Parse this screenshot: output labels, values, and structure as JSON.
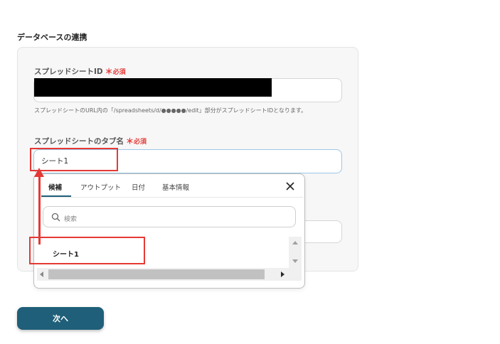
{
  "section": {
    "title": "データベースの連携"
  },
  "spreadsheet_id": {
    "label": "スプレッドシートID",
    "required_mark": "＊",
    "required_text": "必須",
    "help": "スプレッドシートのURL内の「/spreadsheets/d/●●●●●/edit」部分がスプレッドシートIDとなります。"
  },
  "tab_name": {
    "label": "スプレッドシートのタブ名",
    "required_mark": "＊",
    "required_text": "必須",
    "value": "シート1"
  },
  "popup": {
    "tabs": [
      "候補",
      "アウトプット",
      "日付",
      "基本情報"
    ],
    "search_placeholder": "検索",
    "options": [
      "シート1"
    ]
  },
  "next_button": "次へ",
  "colors": {
    "accent": "#1f5f79",
    "required": "#e53935",
    "annotation": "#e53935"
  }
}
